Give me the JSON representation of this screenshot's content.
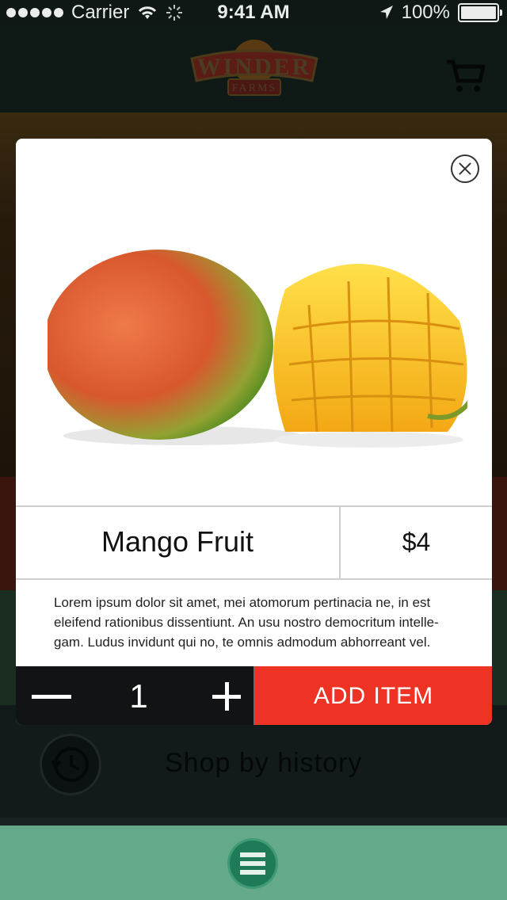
{
  "status_bar": {
    "carrier": "Carrier",
    "time": "9:41 AM",
    "battery": "100%"
  },
  "header": {
    "logo_text_top": "WINDER",
    "logo_text_bottom": "FARMS"
  },
  "background": {
    "history_label": "Shop by history"
  },
  "modal": {
    "product_name": "Mango Fruit",
    "price": "$4",
    "description": "Lorem ipsum dolor sit amet, mei atomorum pertinacia ne, in est eleifend rationibus dissentiunt. An usu nostro democritum intelle-gam. Ludus invidunt qui no, te omnis admodum abhorreant vel.",
    "quantity": "1",
    "add_label": "ADD ITEM"
  },
  "colors": {
    "accent_red": "#ee3324",
    "bottom_bar_green": "#63a98a",
    "menu_button_green": "#1e7a57"
  }
}
